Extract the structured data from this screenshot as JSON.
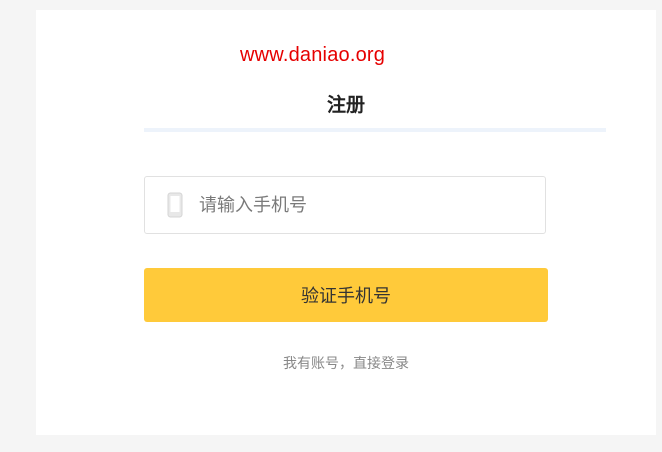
{
  "watermark": {
    "text": "www.daniao.org",
    "color": "#e60000"
  },
  "form": {
    "title": "注册",
    "phone": {
      "icon": "phone-icon",
      "placeholder": "请输入手机号",
      "value": ""
    },
    "verify_button_label": "验证手机号",
    "login_link": "我有账号，直接登录"
  },
  "colors": {
    "accent": "#ffca3a",
    "title_underline": "#edf3fb"
  }
}
